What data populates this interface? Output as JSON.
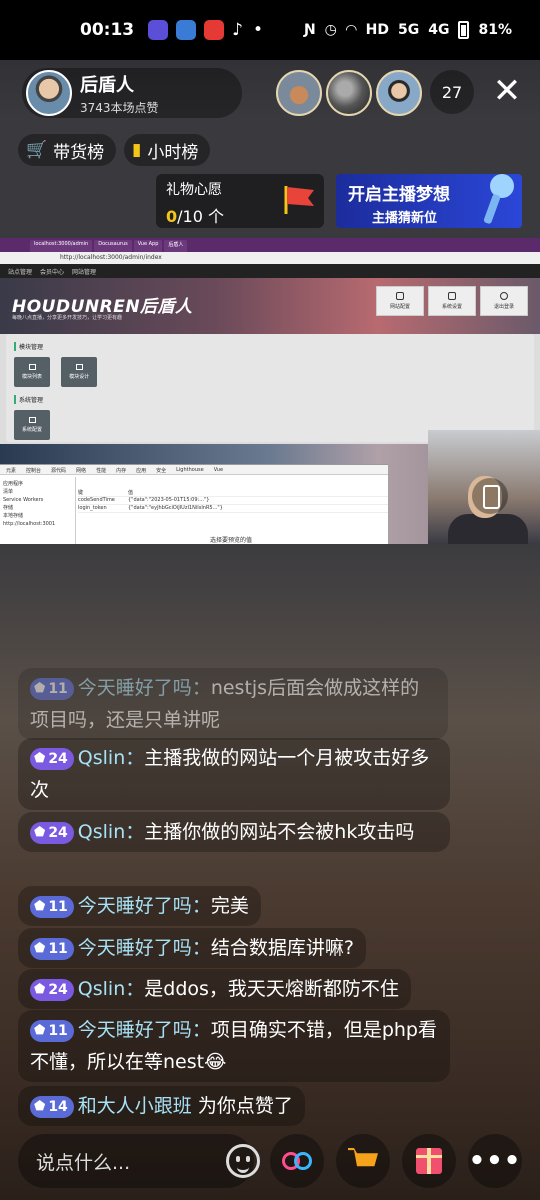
{
  "status_bar": {
    "time": "00:13",
    "battery": "81%",
    "signal_a": "5G",
    "signal_b": "4G",
    "hd": "HD"
  },
  "host": {
    "name": "后盾人",
    "likes": "3743本场点赞"
  },
  "viewers": {
    "count": "27"
  },
  "ranks": {
    "goods": "带货榜",
    "hourly": "小时榜"
  },
  "wish": {
    "title": "礼物心愿",
    "current": "0",
    "total": "/10 个"
  },
  "promo": {
    "title": "开启主播梦想",
    "subtitle": "主播猜新位"
  },
  "screen": {
    "tabs": [
      "localhost:3000/admin",
      "Docusaurus",
      "Vue App",
      "后盾人"
    ],
    "address": "http://localhost:3000/admin/index",
    "nav": [
      "站点管理",
      "会员中心",
      "网站管理"
    ],
    "logo": "HOUDUNREN后盾人",
    "tagline": "每晚八点直播，分享更多开发技巧，让学习更有趣",
    "hero_buttons": [
      "网站配置",
      "系统设置",
      "退出登录"
    ],
    "section1": "模块管理",
    "tiles1": [
      "模块列表",
      "模块设计"
    ],
    "section2": "系统管理",
    "tiles2": [
      "系统配置"
    ],
    "devtools_tabs": [
      "元素",
      "控制台",
      "源代码",
      "网络",
      "性能",
      "内存",
      "应用",
      "安全",
      "Lighthouse",
      "Vue"
    ],
    "devtools_side": [
      "应用程序",
      "清单",
      "Service Workers",
      "存储",
      "本地存储",
      "http://localhost:3001"
    ],
    "devtools_rows": [
      {
        "key": "键",
        "val": "值"
      },
      {
        "key": "codeSendTime",
        "val": "{\"data\":\"2023-05-01T15:09:...\"}"
      },
      {
        "key": "login_token",
        "val": "{\"data\":\"eyJhbGciOiJIUzI1NiIsInR5...\"}"
      }
    ],
    "devtools_hint": "选择要预览的值",
    "cam_time": "10:1"
  },
  "chat": [
    {
      "level": "11",
      "user": "今天睡好了吗",
      "text": "nestjs后面会做成这样的项目吗，还是只单讲呢"
    },
    {
      "level": "24",
      "user": "Qslin",
      "text": "主播我做的网站一个月被攻击好多次"
    },
    {
      "level": "24",
      "user": "Qslin",
      "text": "主播你做的网站不会被hk攻击吗"
    },
    {
      "level": "11",
      "user": "今天睡好了吗",
      "text": "完美"
    },
    {
      "level": "11",
      "user": "今天睡好了吗",
      "text": "结合数据库讲嘛?"
    },
    {
      "level": "24",
      "user": "Qslin",
      "text": "是ddos，我天天熔断都防不住"
    },
    {
      "level": "11",
      "user": "今天睡好了吗",
      "text": "项目确实不错，但是php看不懂，所以在等nest😂"
    },
    {
      "level": "14",
      "user": "和大人小跟班",
      "text": "为你点赞了"
    }
  ],
  "bottom": {
    "placeholder": "说点什么..."
  },
  "colors": {
    "accent": "#f5c518",
    "username": "#a7e1f5",
    "promo": "#2b47d8"
  }
}
